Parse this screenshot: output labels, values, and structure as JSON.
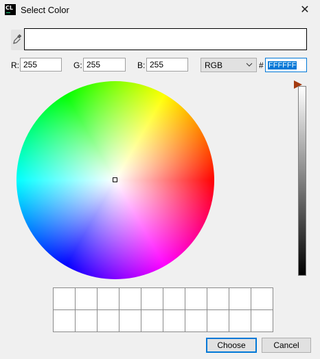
{
  "titlebar": {
    "app_icon_text": "CL",
    "title": "Select Color",
    "close_glyph": "✕"
  },
  "color_fields": {
    "r_label": "R:",
    "r_value": "255",
    "g_label": "G:",
    "g_value": "255",
    "b_label": "B:",
    "b_value": "255",
    "mode": "RGB",
    "hash": "#",
    "hex_value": "FFFFFF"
  },
  "icons": {
    "eyedropper": "eyedropper-icon",
    "chevron": "chevron-down-icon"
  },
  "colors": {
    "accent": "#0078d7",
    "slider_thumb": "#a33a10",
    "background": "#f0f0f0"
  },
  "selection": {
    "hue_deg": 0,
    "saturation": 0,
    "brightness": 1
  },
  "buttons": {
    "choose": "Choose",
    "cancel": "Cancel"
  }
}
